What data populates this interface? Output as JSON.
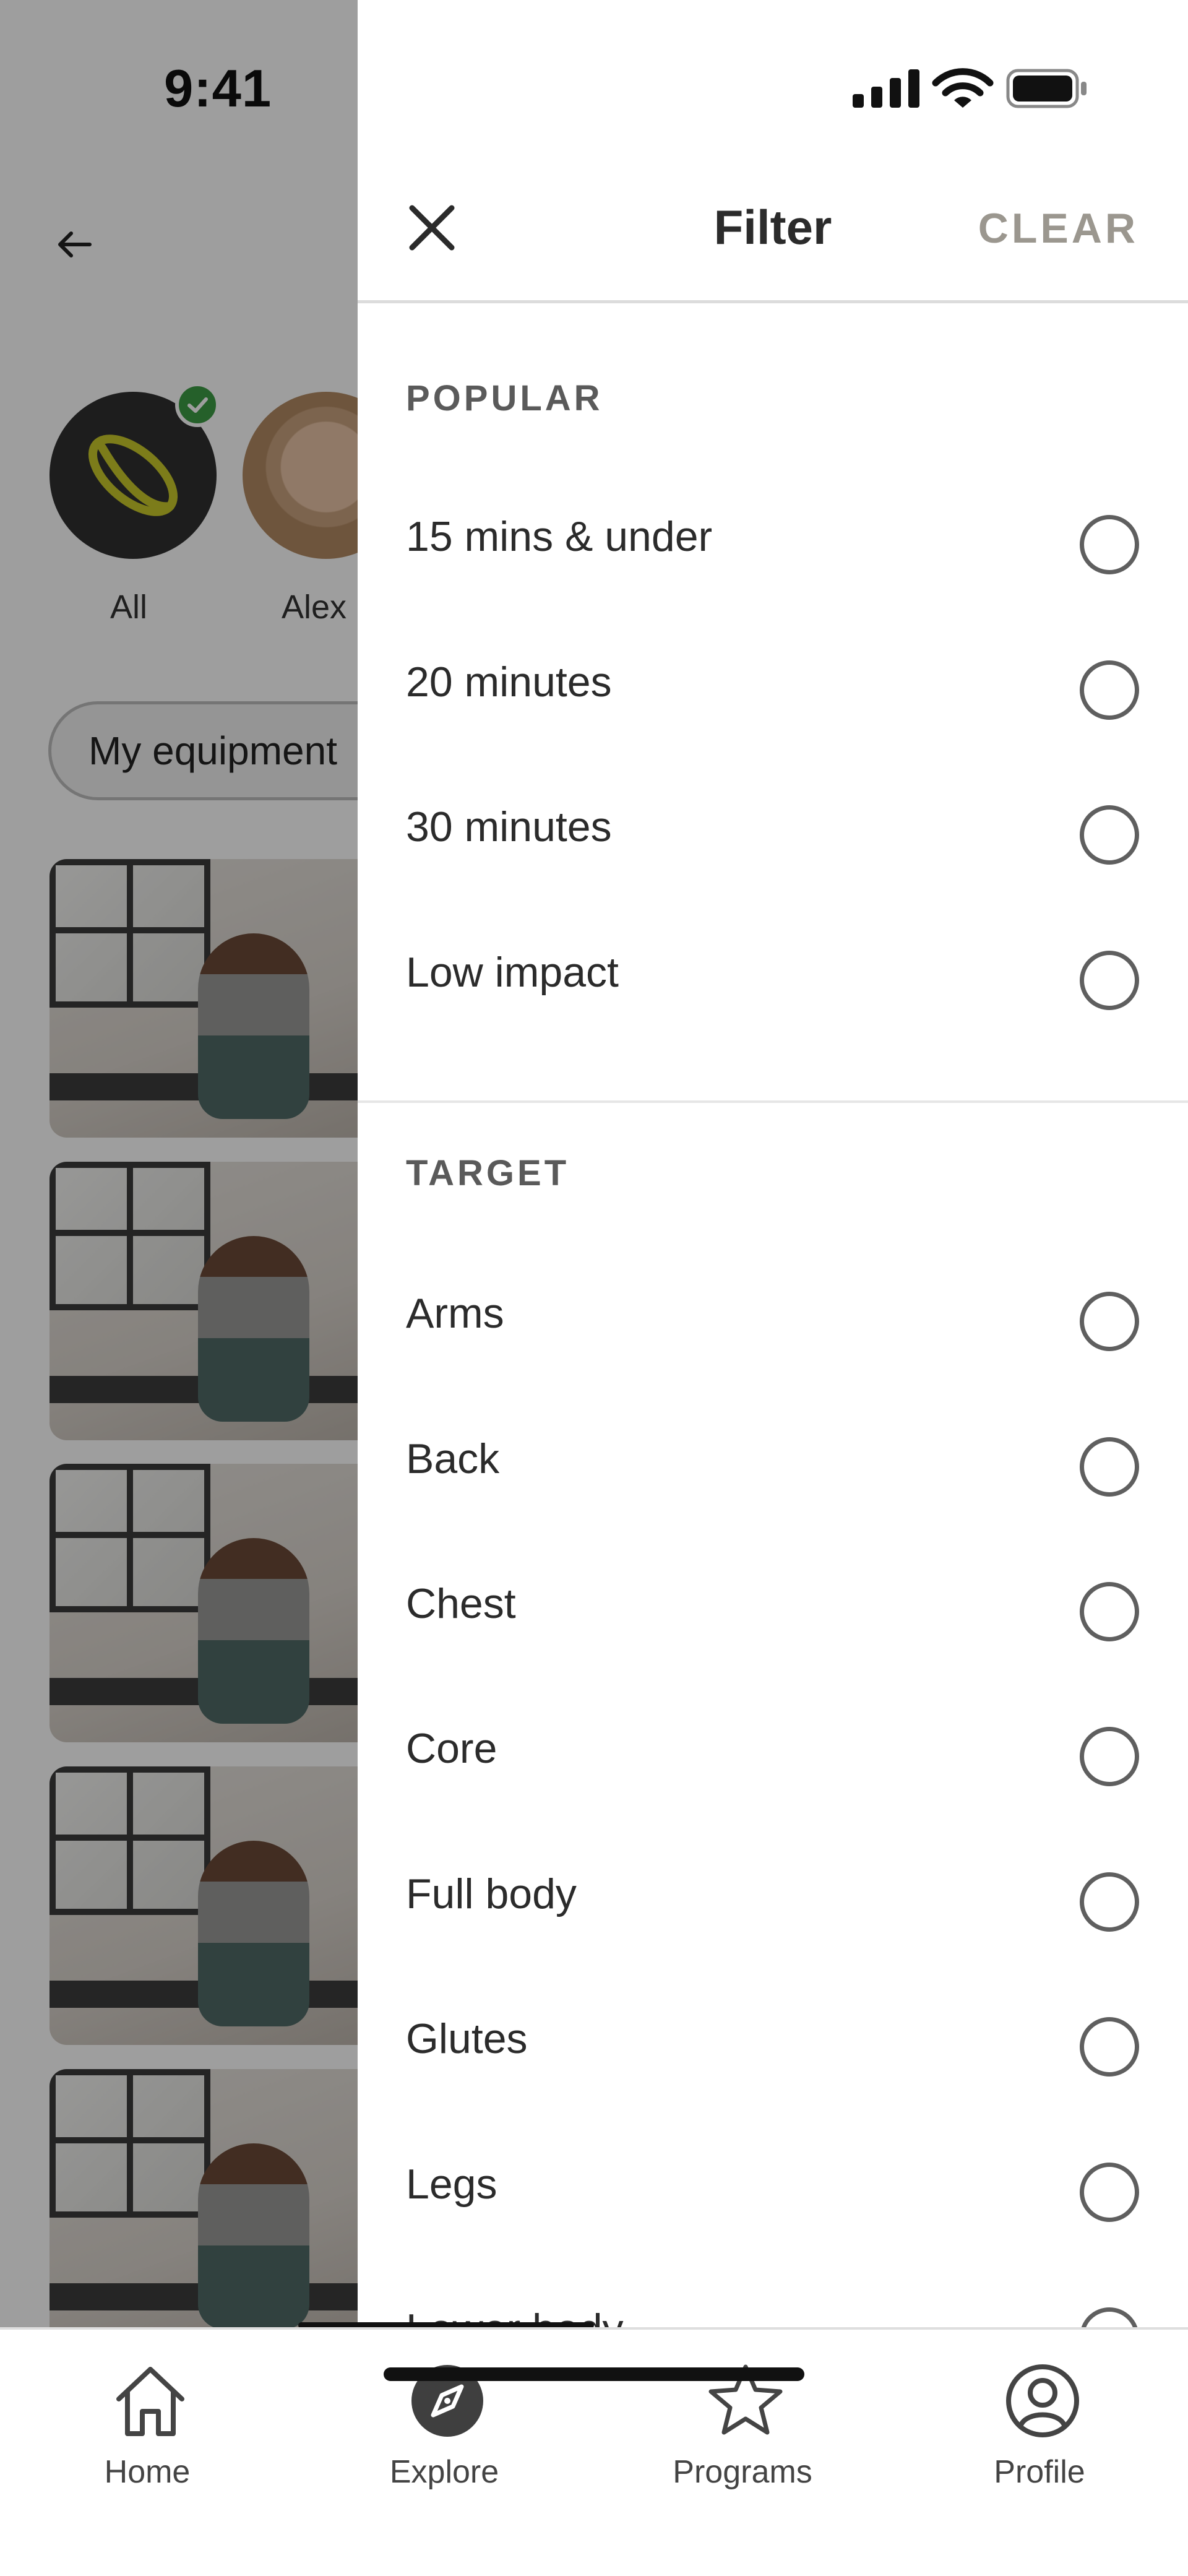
{
  "status_bar": {
    "time": "9:41"
  },
  "background": {
    "avatars": [
      {
        "label": "All"
      },
      {
        "label": "Alex"
      }
    ],
    "chip_label": "My equipment"
  },
  "filter": {
    "title": "Filter",
    "clear_label": "CLEAR",
    "sections": [
      {
        "heading": "POPULAR",
        "options": [
          "15 mins & under",
          "20 minutes",
          "30 minutes",
          "Low impact"
        ]
      },
      {
        "heading": "TARGET",
        "options": [
          "Arms",
          "Back",
          "Chest",
          "Core",
          "Full body",
          "Glutes",
          "Legs",
          "Lower body"
        ]
      }
    ]
  },
  "tabbar": {
    "tabs": [
      {
        "label": "Home",
        "icon": "home-icon"
      },
      {
        "label": "Explore",
        "icon": "compass-icon",
        "active": true
      },
      {
        "label": "Programs",
        "icon": "star-icon"
      },
      {
        "label": "Profile",
        "icon": "profile-icon"
      }
    ]
  },
  "colors": {
    "accent_check": "#3d9b45",
    "logo_yellow": "#c8c82a",
    "clear_text": "#9b978f"
  }
}
